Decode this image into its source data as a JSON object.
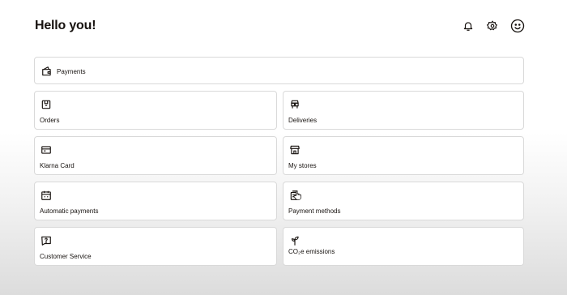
{
  "header": {
    "title": "Hello you!",
    "icons": [
      "bell-icon",
      "gear-icon",
      "smiley-icon"
    ]
  },
  "payments_card": {
    "label": "Payments",
    "icon": "wallet-icon"
  },
  "tiles": [
    {
      "label": "Orders",
      "icon": "order-box-icon"
    },
    {
      "label": "Deliveries",
      "icon": "delivery-icon"
    },
    {
      "label": "Klarna Card",
      "icon": "card-icon"
    },
    {
      "label": "My stores",
      "icon": "store-icon"
    },
    {
      "label": "Automatic payments",
      "icon": "calendar-icon"
    },
    {
      "label": "Payment methods",
      "icon": "payment-methods-icon"
    },
    {
      "label": "Customer Service",
      "icon": "help-icon"
    },
    {
      "label": "CO₂e emissions",
      "icon": "plant-icon"
    }
  ],
  "colors": {
    "text": "#17120f",
    "border": "#d9d9d9",
    "card": "#ffffff"
  }
}
